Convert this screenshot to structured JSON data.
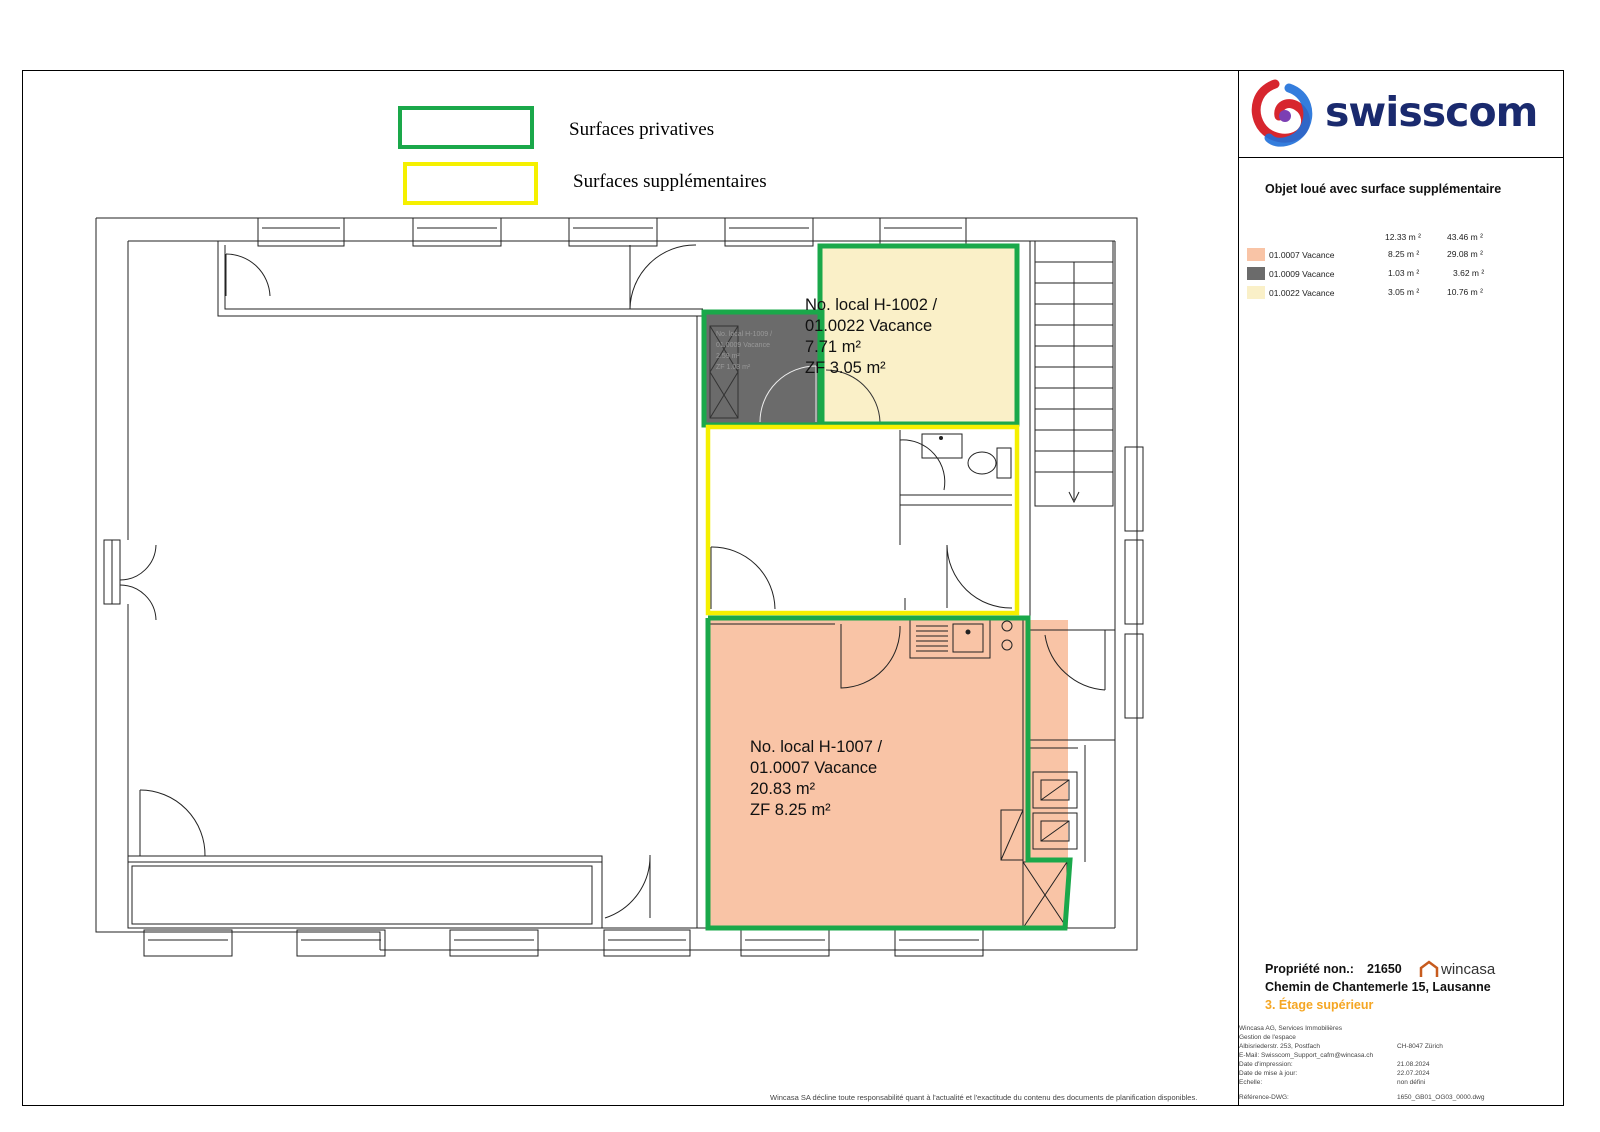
{
  "legend": {
    "private_label": "Surfaces privatives",
    "supplementary_label": "Surfaces supplémentaires"
  },
  "rooms": {
    "h1002": {
      "l1": "No. local H-1002 /",
      "l2": "01.0022 Vacance",
      "l3": "7.71 m²",
      "l4": "ZF 3.05 m²"
    },
    "h1009": {
      "l1": "No. local H-1009 /",
      "l2": "01.0009 Vacance",
      "l3": "2.59 m²",
      "l4": "ZF 1.03 m²"
    },
    "h1007": {
      "l1": "No. local H-1007 /",
      "l2": "01.0007 Vacance",
      "l3": "20.83 m²",
      "l4": "ZF 8.25 m²"
    }
  },
  "side": {
    "brand": "swisscom",
    "title": "Objet loué avec surface supplémentaire",
    "table": {
      "head_a": "12.33 m ²",
      "head_b": "43.46 m ²",
      "rows": [
        {
          "label": "01.0007 Vacance",
          "a": "8.25 m ²",
          "b": "29.08 m ²",
          "color": "#f9c4a6"
        },
        {
          "label": "01.0009 Vacance",
          "a": "1.03 m ²",
          "b": "3.62 m ²",
          "color": "#6b6b6b"
        },
        {
          "label": "01.0022 Vacance",
          "a": "3.05 m ²",
          "b": "10.76 m ²",
          "color": "#faf0c8"
        }
      ]
    },
    "property_label": "Propriété non.:",
    "property_no": "21650",
    "wincasa": "wincasa",
    "address": "Chemin de Chantemerle 15, Lausanne",
    "floor": "3. Étage supérieur",
    "company": "Wincasa AG, Services Immobilières",
    "dept": "Gestion de l'espace",
    "street": "Albisriederstr. 253, Postfach",
    "city": "CH-8047 Zürich",
    "email": "E-Mail: Swisscom_Support_cafm@wincasa.ch",
    "print_label": "Date d'impression:",
    "print_date": "21.08.2024",
    "update_label": "Date de mise à jour:",
    "update_date": "22.07.2024",
    "scale_label": "Echelle:",
    "scale_value": "non défini",
    "ref_label": "Référence-DWG:",
    "ref_value": "1650_GB01_OG03_0000.dwg"
  },
  "disclaimer": "Wincasa SA décline toute responsabilité quant à l'actualité et l'exactitude du contenu des documents de planification disponibles.",
  "colors": {
    "private": "#1aa84a",
    "supplementary": "#f5f000",
    "salmon": "#f9c4a6",
    "cream": "#faf0c8",
    "grey": "#6b6b6b"
  }
}
